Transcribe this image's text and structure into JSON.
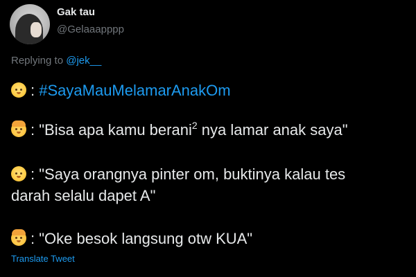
{
  "user": {
    "display_name": "Gak tau",
    "handle": "@Gelaaapppp"
  },
  "reply": {
    "prefix": "Replying to",
    "mention": "@jek__"
  },
  "tweet": {
    "line1_sep": ":",
    "line1_hashtag": "#SayaMauMelamarAnakOm",
    "line2_pre": ": \"Bisa apa kamu berani",
    "line2_sup": "2",
    "line2_post": " nya lamar anak saya\"",
    "line3": ": \"Saya orangnya pinter om, buktinya kalau tes",
    "line4": "darah selalu dapet A\"",
    "line5": ": \"Oke besok langsung otw KUA\""
  },
  "emojis": [
    "baby-face-emoji",
    "older-person-emoji",
    "baby-face-emoji",
    "older-person-emoji"
  ],
  "translate_label": "Translate Tweet",
  "colors": {
    "background": "#000000",
    "text": "#e7e9ea",
    "secondary": "#71767b",
    "accent": "#1d9bf0"
  }
}
